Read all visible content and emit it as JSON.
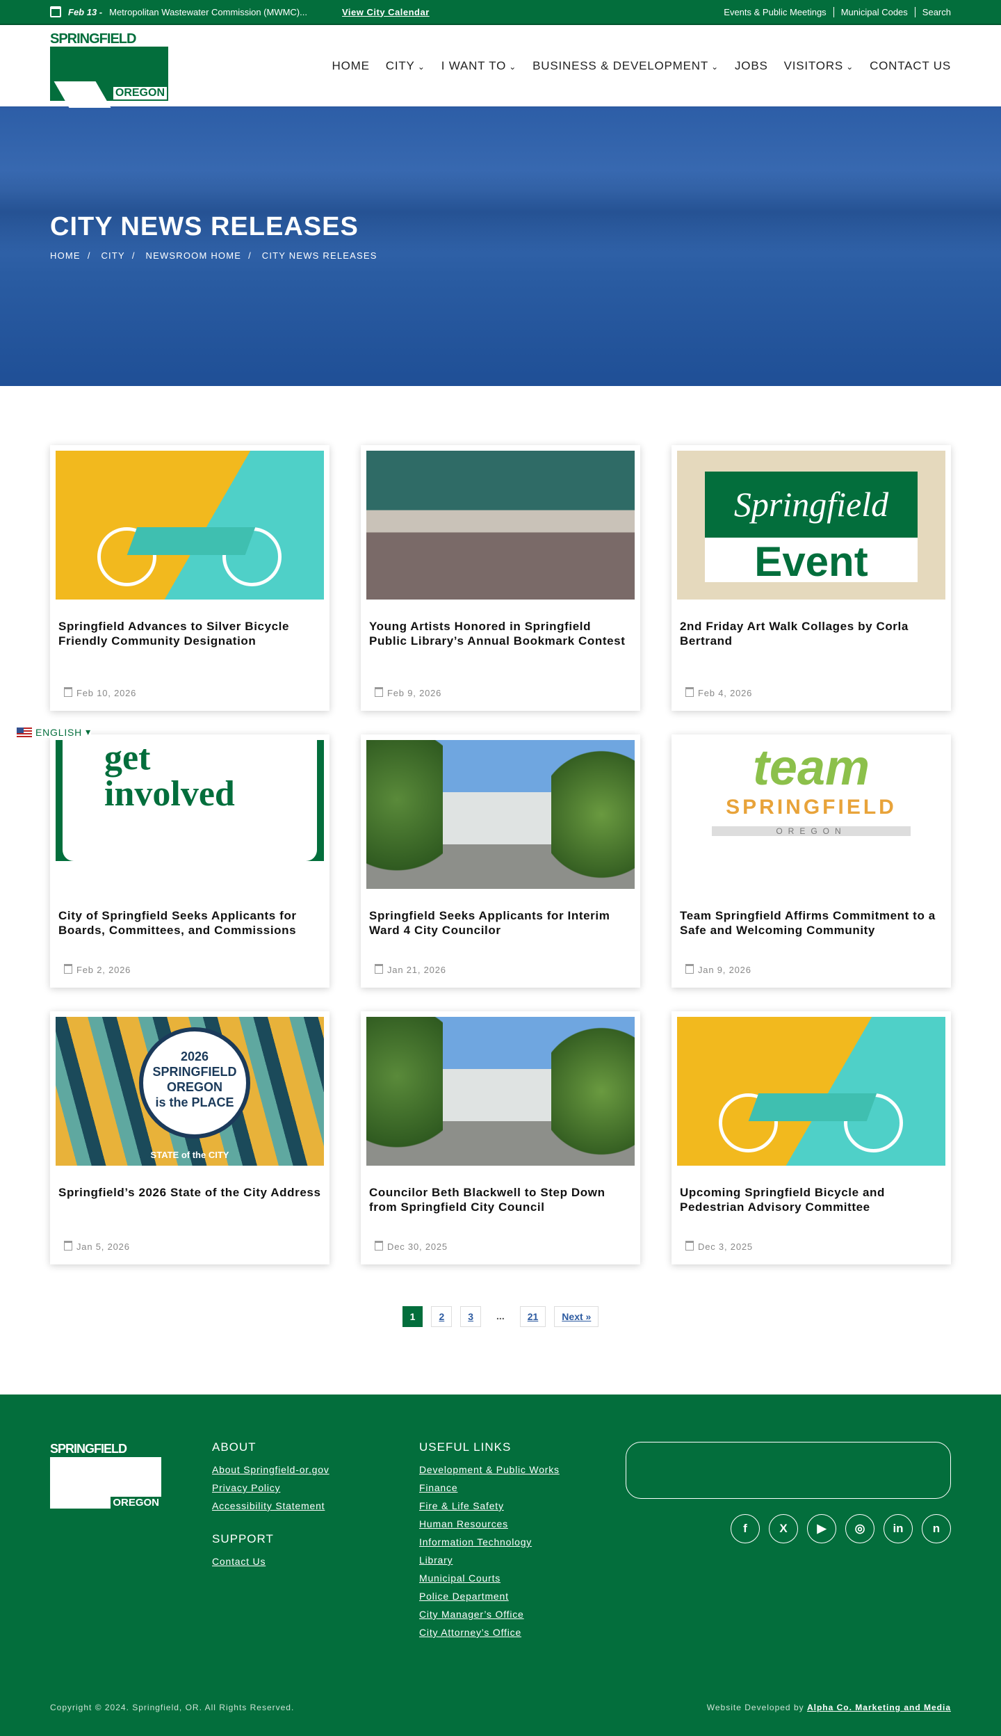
{
  "topbar": {
    "event_date": "Feb 13 -",
    "event_title": "Metropolitan Wastewater Commission (MWMC)...",
    "calendar_link": "View City Calendar",
    "links": [
      "Events & Public Meetings",
      "Municipal Codes",
      "Search"
    ]
  },
  "logo": {
    "top": "SPRINGFIELD",
    "bottom": "OREGON"
  },
  "nav": [
    "HOME",
    "CITY",
    "I WANT TO",
    "BUSINESS & DEVELOPMENT",
    "JOBS",
    "VISITORS",
    "CONTACT US"
  ],
  "hero": {
    "title": "CITY NEWS RELEASES",
    "breadcrumbs": [
      "HOME",
      "CITY",
      "NEWSROOM HOME",
      "CITY NEWS RELEASES"
    ]
  },
  "language": "ENGLISH",
  "cards": [
    {
      "title": "Springfield Advances to Silver Bicycle Friendly Community Designation",
      "date": "Feb 10, 2026",
      "image": "bicycle"
    },
    {
      "title": "Young Artists Honored in Springfield Public Library’s Annual Bookmark Contest",
      "date": "Feb 9, 2026",
      "image": "group-photo"
    },
    {
      "title": "2nd Friday Art Walk Collages by Corla Bertrand",
      "date": "Feb 4, 2026",
      "image": "springfield-event",
      "image_text": [
        "Springfield",
        "Event"
      ]
    },
    {
      "title": "City of Springfield Seeks Applicants for Boards, Committees, and Commissions",
      "date": "Feb 2, 2026",
      "image": "get-involved",
      "image_text": [
        "get",
        "involved"
      ]
    },
    {
      "title": "Springfield Seeks Applicants for Interim Ward 4 City Councilor",
      "date": "Jan 21, 2026",
      "image": "city-hall"
    },
    {
      "title": "Team Springfield Affirms Commitment to a Safe and Welcoming Community",
      "date": "Jan 9, 2026",
      "image": "team-springfield",
      "image_text": [
        "team",
        "SPRINGFIELD",
        "OREGON"
      ]
    },
    {
      "title": "Springfield’s 2026 State of the City Address",
      "date": "Jan 5, 2026",
      "image": "state-of-city",
      "image_text": [
        "2026",
        "SPRINGFIELD OREGON",
        "is the PLACE",
        "STATE of the CITY"
      ]
    },
    {
      "title": "Councilor Beth Blackwell to Step Down from Springfield City Council",
      "date": "Dec 30, 2025",
      "image": "city-hall"
    },
    {
      "title": "Upcoming Springfield Bicycle and Pedestrian Advisory Committee",
      "date": "Dec 3, 2025",
      "image": "bicycle"
    }
  ],
  "pagination": {
    "current": "1",
    "pages": [
      "2",
      "3"
    ],
    "dots": "...",
    "last": "21",
    "next": "Next »"
  },
  "footer": {
    "about": {
      "heading": "ABOUT",
      "links": [
        "About Springfield-or.gov",
        "Privacy Policy",
        "Accessibility Statement"
      ]
    },
    "support": {
      "heading": "SUPPORT",
      "links": [
        "Contact Us"
      ]
    },
    "useful": {
      "heading": "USEFUL LINKS",
      "links": [
        "Development & Public Works",
        "Finance",
        "Fire & Life Safety",
        "Human Resources",
        "Information Technology",
        "Library",
        "Municipal Courts",
        "Police Department",
        "City Manager’s Office",
        "City Attorney’s Office"
      ]
    },
    "social": [
      "facebook",
      "x",
      "youtube",
      "instagram",
      "linkedin",
      "nextdoor"
    ],
    "copyright": "Copyright © 2024. Springfield, OR. All Rights Reserved.",
    "developed_prefix": "Website Developed by",
    "developer": "Alpha Co. Marketing and Media"
  },
  "colors": {
    "brand_green": "#036e3c",
    "link_blue": "#2c5aa0"
  }
}
